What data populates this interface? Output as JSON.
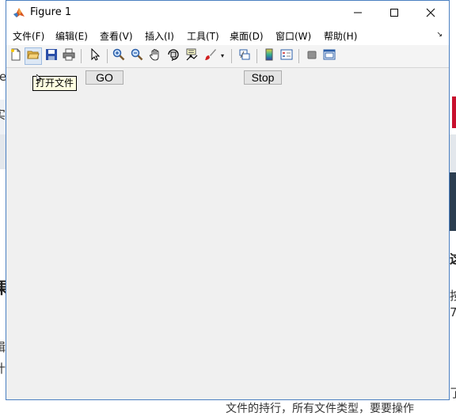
{
  "window": {
    "title": "Figure 1",
    "minimize_glyph": "—",
    "maximize_glyph": "☐",
    "close_glyph": "✕"
  },
  "menu": {
    "items": [
      {
        "label": "文件(F)"
      },
      {
        "label": "编辑(E)"
      },
      {
        "label": "查看(V)"
      },
      {
        "label": "插入(I)"
      },
      {
        "label": "工具(T)"
      },
      {
        "label": "桌面(D)"
      },
      {
        "label": "窗口(W)"
      },
      {
        "label": "帮助(H)"
      }
    ],
    "dock_glyph": "↘"
  },
  "toolbar": {
    "icons": [
      "new-file-icon",
      "open-file-icon",
      "save-icon",
      "print-icon",
      "select-arrow-icon",
      "zoom-in-icon",
      "zoom-out-icon",
      "pan-hand-icon",
      "rotate-3d-icon",
      "data-cursor-icon",
      "brush-icon",
      "link-plot-icon",
      "colorbar-icon",
      "legend-icon",
      "hide-plot-tools-icon",
      "show-plot-tools-icon"
    ]
  },
  "tooltip": {
    "text": "打开文件"
  },
  "buttons": {
    "go_label": "GO",
    "stop_label": "Stop"
  },
  "background": {
    "left_fragments": [
      "e",
      "实",
      "果",
      "辑",
      "计"
    ],
    "right_fragments": [
      "这",
      "按",
      "7",
      "了"
    ],
    "bottom_text": "文件的持行，所有文件类型，要要操作"
  },
  "colors": {
    "window_border": "#4a7fc1",
    "figure_background": "#f0f0f0",
    "accent_red": "#c8102e"
  }
}
